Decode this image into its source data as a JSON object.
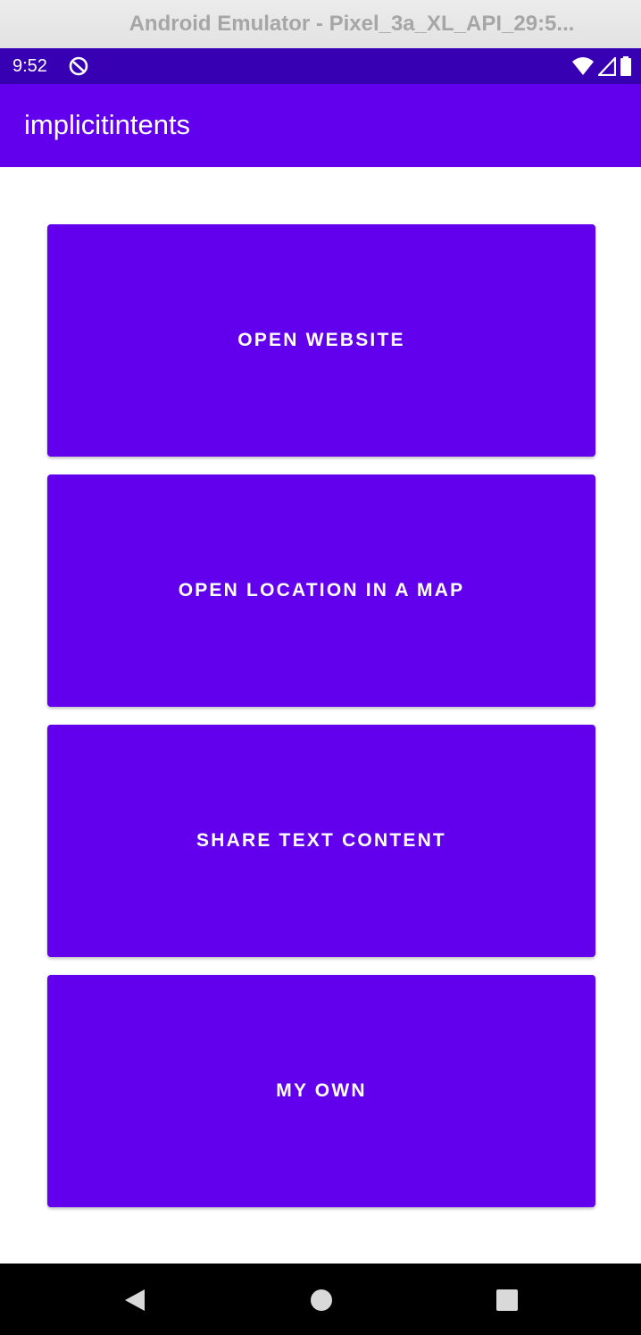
{
  "window": {
    "title": "Android Emulator - Pixel_3a_XL_API_29:5..."
  },
  "status_bar": {
    "time": "9:52",
    "icons": [
      "sync-icon",
      "wifi-icon",
      "cell-signal-icon",
      "battery-icon"
    ],
    "color": "#3700b3"
  },
  "app_bar": {
    "title": "implicitintents",
    "color": "#6200ee"
  },
  "buttons": [
    {
      "label": "OPEN WEBSITE"
    },
    {
      "label": "OPEN LOCATION IN A MAP"
    },
    {
      "label": "SHARE TEXT CONTENT"
    },
    {
      "label": "MY OWN"
    }
  ],
  "nav_bar": {
    "icons": [
      "back-icon",
      "home-icon",
      "recents-icon"
    ]
  },
  "colors": {
    "primary": "#6200ee",
    "primary_dark": "#3700b3",
    "on_primary": "#ffffff",
    "background": "#ffffff"
  }
}
